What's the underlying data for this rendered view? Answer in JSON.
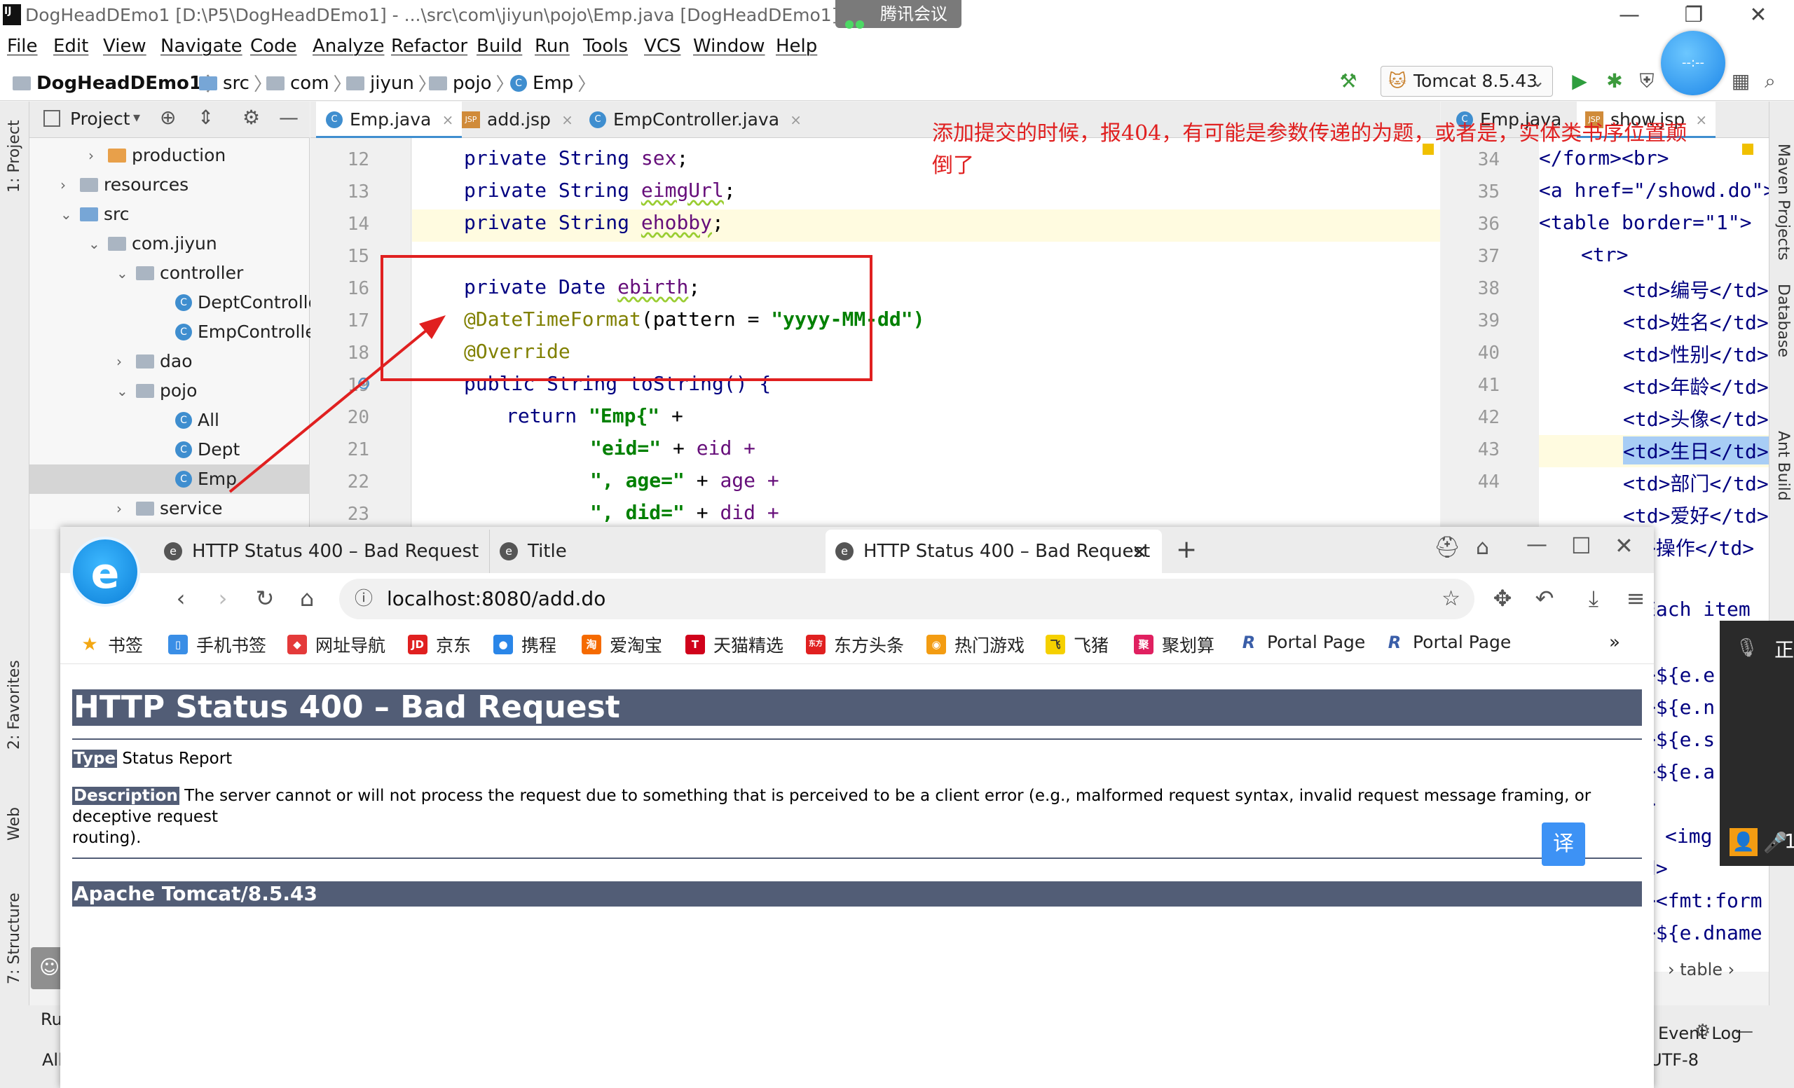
{
  "window": {
    "title": "DogHeadDEmo1 [D:\\P5\\DogHeadDEmo1] - ...\\src\\com\\jiyun\\pojo\\Emp.java [DogHeadDEmo1] - IntelliJ",
    "overlay_app": "腾讯会议",
    "logo_text": "IJ"
  },
  "menu": [
    "File",
    "Edit",
    "View",
    "Navigate",
    "Code",
    "Analyze",
    "Refactor",
    "Build",
    "Run",
    "Tools",
    "VCS",
    "Window",
    "Help"
  ],
  "breadcrumb": [
    "DogHeadDEmo1",
    "src",
    "com",
    "jiyun",
    "pojo",
    "Emp"
  ],
  "run_config": "Tomcat 8.5.43",
  "clock_text": "--:--",
  "left_strip": {
    "project": "1: Project",
    "favorites": "2: Favorites",
    "web": "Web",
    "structure": "7: Structure"
  },
  "project_panel": {
    "title": "Project",
    "tree": [
      {
        "label": "production",
        "type": "folder-orange",
        "arrow": "›"
      },
      {
        "label": "resources",
        "type": "folder-gray",
        "arrow": "›"
      },
      {
        "label": "src",
        "type": "folder-blue",
        "arrow": "⌄"
      },
      {
        "label": "com.jiyun",
        "type": "folder-gray",
        "arrow": "⌄"
      },
      {
        "label": "controller",
        "type": "folder-gray",
        "arrow": "⌄"
      },
      {
        "label": "DeptControlle",
        "type": "class"
      },
      {
        "label": "EmpControlle",
        "type": "class"
      },
      {
        "label": "dao",
        "type": "folder-gray",
        "arrow": "›"
      },
      {
        "label": "pojo",
        "type": "folder-gray",
        "arrow": "⌄"
      },
      {
        "label": "All",
        "type": "class"
      },
      {
        "label": "Dept",
        "type": "class"
      },
      {
        "label": "Emp",
        "type": "class"
      },
      {
        "label": "service",
        "type": "folder-gray",
        "arrow": "›"
      }
    ]
  },
  "editor_tabs": [
    {
      "label": "Emp.java",
      "icon": "C",
      "close": "×"
    },
    {
      "label": "add.jsp",
      "icon": "JSP",
      "close": "×"
    },
    {
      "label": "EmpController.java",
      "icon": "C",
      "close": "×"
    }
  ],
  "code": {
    "line_numbers": [
      "12",
      "13",
      "14",
      "15",
      "16",
      "17",
      "18",
      "19",
      "20",
      "21",
      "22",
      "23"
    ],
    "lines": [
      {
        "a": "private String ",
        "b": "sex",
        "c": ";"
      },
      {
        "a": "private String ",
        "b": "eimgUrl",
        "c": ";"
      },
      {
        "a": "private String ",
        "b": "ehobby",
        "c": ";"
      },
      {
        "a": "",
        "b": "",
        "c": ""
      },
      {
        "a": "private Date ",
        "b": "ebirth",
        "c": ";"
      },
      {
        "a": "@DateTimeFormat",
        "b": "(pattern = ",
        "c": "\"yyyy-MM-dd\")"
      },
      {
        "a": "@Override",
        "b": "",
        "c": ""
      },
      {
        "a": "public String toString() {",
        "b": "",
        "c": ""
      },
      {
        "a": "return ",
        "b": "\"Emp{\"",
        "c": " +"
      },
      {
        "a": "\"eid=\"",
        "b": " + ",
        "c": "eid +"
      },
      {
        "a": "\", age=\"",
        "b": " + ",
        "c": "age +"
      },
      {
        "a": "\", did=\"",
        "b": " + ",
        "c": "did +"
      }
    ]
  },
  "right_editor": {
    "tabs": [
      "Emp.java",
      "show.jsp"
    ],
    "line_numbers": [
      "34",
      "35",
      "36",
      "37",
      "38",
      "39",
      "40",
      "41",
      "42",
      "43",
      "44"
    ],
    "lines": [
      "</form><br>",
      "<a href=\"/showd.do\">",
      "<table border=\"1\">",
      "<tr>",
      "<td>编号</td>",
      "<td>姓名</td>",
      "<td>性别</td>",
      "<td>年龄</td>",
      "<td>头像</td>",
      "<td>生日</td>",
      "<td>部门</td>",
      "<td>爱好</td>",
      ">操作</td>",
      "Each item",
      ">${e.e",
      ">${e.n",
      ">${e.s",
      ">${e.a",
      ">",
      "<img",
      "d>",
      "><fmt:form",
      ">${e.dname"
    ],
    "crumb": "table"
  },
  "right_strip": [
    "Maven Projects",
    "Database",
    "Ant Build"
  ],
  "annotation": "添加提交的时候，报404，有可能是参数传递的为题，或者是，实体类书序位置颠倒了",
  "bottom": {
    "run": "Ru",
    "all": "All",
    "event_log": "Event Log",
    "encoding": "UTF-8"
  },
  "browser": {
    "logo": "e",
    "tabs": [
      {
        "label": "HTTP Status 400 – Bad Request"
      },
      {
        "label": "Title"
      },
      {
        "label": "HTTP Status 400 – Bad Request",
        "close": "×"
      }
    ],
    "new_tab": "+",
    "address": "localhost:8080/add.do",
    "bookmarks": [
      "书签",
      "手机书签",
      "网址导航",
      "京东",
      "携程",
      "爱淘宝",
      "天猫精选",
      "东方头条",
      "热门游戏",
      "飞猪",
      "聚划算",
      "Portal Page",
      "Portal Page"
    ],
    "more": "»",
    "page": {
      "h1": "HTTP Status 400 – Bad Request",
      "type_label": "Type",
      "type_value": "Status Report",
      "desc_label": "Description",
      "desc_value": "The server cannot or will not process the request due to something that is perceived to be a client error (e.g., malformed request syntax, invalid request message framing, or deceptive request",
      "desc_value2": "routing).",
      "footer": "Apache Tomcat/8.5.43"
    },
    "translate": "译"
  },
  "video_text": {
    "top": "正",
    "bottom": "1"
  },
  "colors": {
    "accent": "#3f8ecf",
    "error_header": "#525d76",
    "annotation": "#e02020"
  }
}
